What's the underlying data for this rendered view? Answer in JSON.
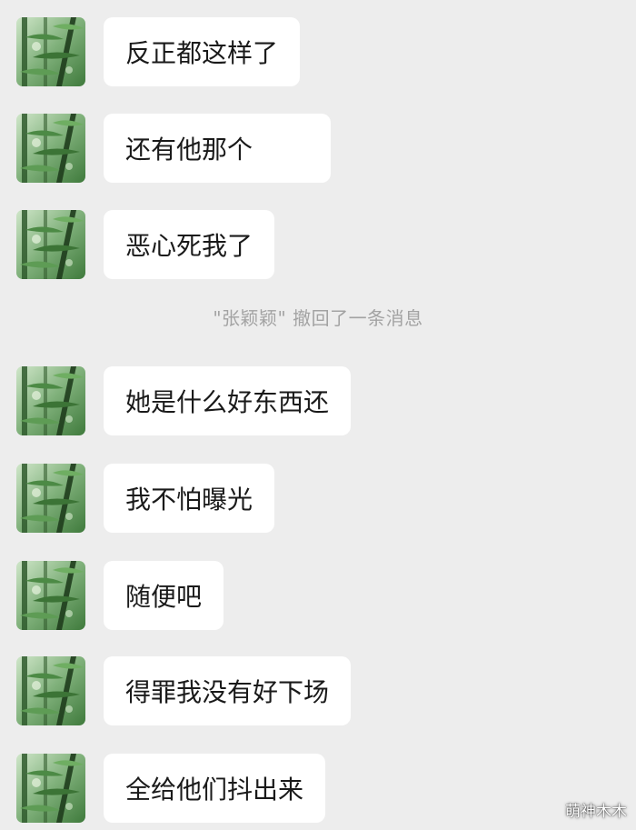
{
  "colors": {
    "background": "#ededed",
    "bubble": "#ffffff",
    "text": "#1a1a1a",
    "notice": "#a3a3a3"
  },
  "messages": [
    {
      "text": "反正都这样了",
      "avatar": "avatar-bamboo"
    },
    {
      "text": "还有他那个",
      "avatar": "avatar-bamboo"
    },
    {
      "text": "恶心死我了",
      "avatar": "avatar-bamboo"
    },
    {
      "text": "她是什么好东西还",
      "avatar": "avatar-bamboo"
    },
    {
      "text": "我不怕曝光",
      "avatar": "avatar-bamboo"
    },
    {
      "text": "随便吧",
      "avatar": "avatar-bamboo"
    },
    {
      "text": "得罪我没有好下场",
      "avatar": "avatar-bamboo"
    },
    {
      "text": "全给他们抖出来",
      "avatar": "avatar-bamboo"
    }
  ],
  "system_notice": "\"张颖颖\" 撤回了一条消息",
  "watermark": "萌神木木"
}
